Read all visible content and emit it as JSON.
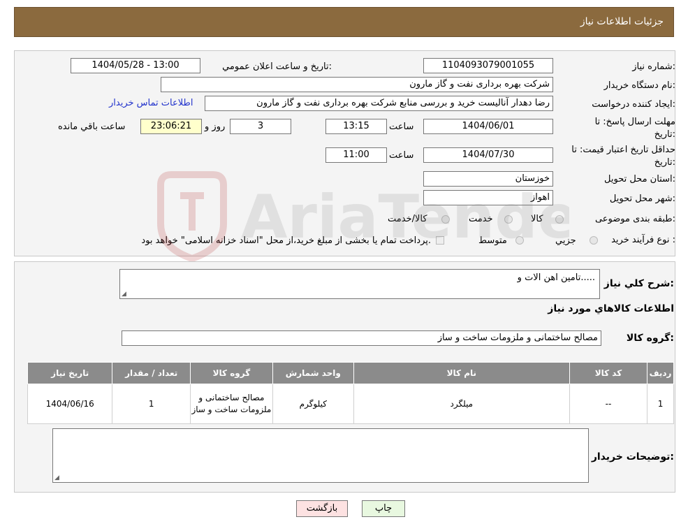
{
  "header": {
    "title": "جزئیات اطلاعات نیاز"
  },
  "form": {
    "need_number_label": "شماره نیاز:",
    "need_number": "1104093079001055",
    "announce_label": "تاریخ و ساعت اعلان عمومي:",
    "announce_value": "1404/05/28 - 13:00",
    "buyer_org_label": "نام دستگاه خريدار:",
    "buyer_org": "شرکت بهره برداری نفت و گاز مارون",
    "creator_label": "ايجاد کننده درخواست:",
    "creator": "رضا دهدار آنالیست خرید و بررسی منابع شرکت بهره برداری نفت و گاز مارون",
    "contact_link": "اطلاعات تماس خریدار",
    "reply_deadline_label": "مهلت ارسال پاسخ: تا تاريخ:",
    "reply_date": "1404/06/01",
    "time_label": "ساعت",
    "reply_time": "13:15",
    "days": "3",
    "days_label": "روز و",
    "remaining": "23:06:21",
    "remaining_label": "ساعت باقي مانده",
    "price_validity_label": "حداقل تاريخ اعتبار قيمت: تا تاريخ:",
    "validity_date": "1404/07/30",
    "validity_time_label": "ساعت",
    "validity_time": "11:00",
    "province_label": "استان محل تحويل:",
    "province": "خوزستان",
    "city_label": "شهر محل تحويل:",
    "city": "اهواز",
    "category_label": "طبقه بندی موضوعی:",
    "category_options": [
      "کالا",
      "خدمت",
      "کالا/خدمت"
    ],
    "process_label": "نوع فرآيند خريد :",
    "process_options": [
      "جزيي",
      "متوسط"
    ],
    "payment_note": "پرداخت تمام يا بخشی از مبلغ خريد،از محل \"اسناد خزانه اسلامی\" خواهد بود."
  },
  "summary": {
    "desc_label": "شرح کلي نياز:",
    "desc_value": "تامین اهن الات و.....",
    "goods_info_title": "اطلاعات کالاهاي مورد نياز",
    "group_label": "گروه کالا:",
    "group_value": "مصالح ساختمانی و ملزومات ساخت و ساز"
  },
  "table": {
    "headers": [
      "رديف",
      "کد کالا",
      "نام کالا",
      "واحد شمارش",
      "گروه کالا",
      "تعداد / مقدار",
      "تاريخ نياز"
    ],
    "rows": [
      [
        "1",
        "--",
        "میلگرد",
        "کیلوگرم",
        "مصالح ساختمانی و ملزومات ساخت و ساز",
        "1",
        "1404/06/16"
      ]
    ]
  },
  "buyer_notes_label": "توضيحات خريدار:",
  "buttons": {
    "print": "چاپ",
    "back": "بازگشت"
  },
  "watermark_text": "AriaTender.neT",
  "colors": {
    "header_bg": "#8b6a3e",
    "table_header_bg": "#8b8b8b",
    "link": "#2233cc",
    "remaining_bg": "#ffffcc",
    "back_btn_bg": "#fde2e2",
    "print_btn_bg": "#e8f8e0"
  }
}
